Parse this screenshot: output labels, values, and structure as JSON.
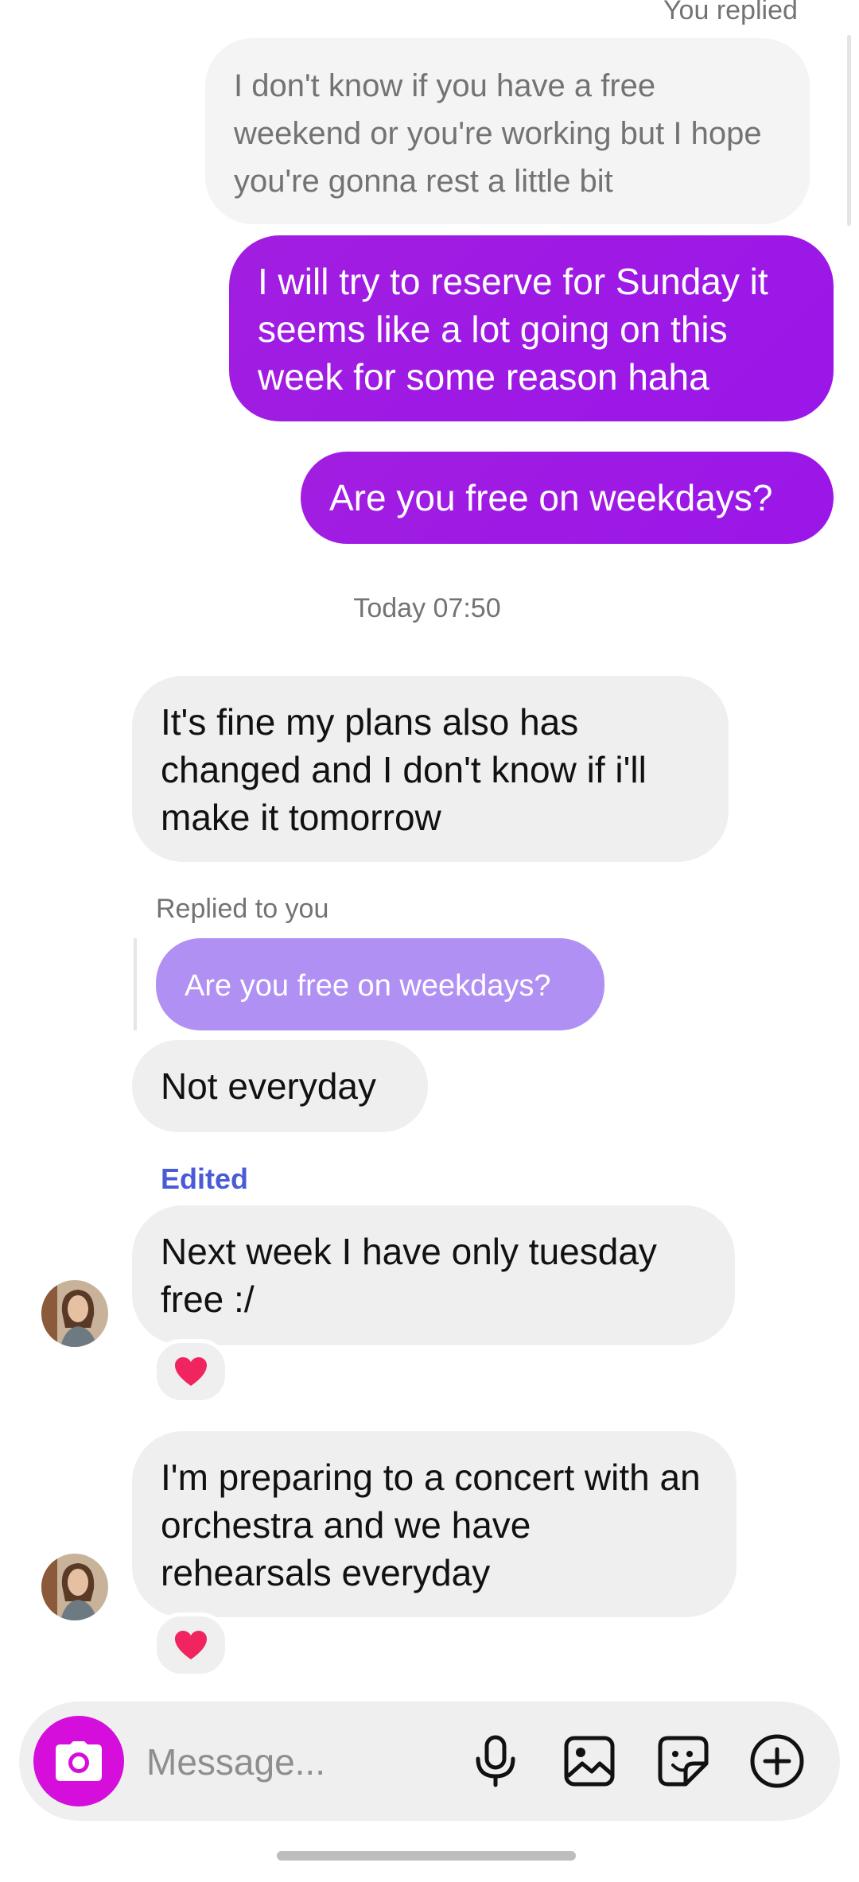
{
  "thread": {
    "you_replied_label": "You replied",
    "quoted_message": "I don't know if you have a free weekend or you're working but I hope you're gonna rest a little bit",
    "outgoing": [
      "I will try to reserve for Sunday it seems like a lot going on this week for some reason haha",
      "Are you free on weekdays?"
    ],
    "timestamp": "Today 07:50",
    "incoming_1": "It's fine my plans also has changed and I don't know if i'll make it tomorrow",
    "replied_to_label": "Replied to you",
    "reply_preview": "Are you free on weekdays?",
    "incoming_2": "Not everyday",
    "edited_label": "Edited",
    "incoming_3": "Next week I have only tuesday free :/",
    "incoming_4": "I'm preparing to a concert with an orchestra and we have rehearsals everyday",
    "reaction_emoji": "heart-icon"
  },
  "composer": {
    "placeholder": "Message...",
    "camera_icon": "camera-icon",
    "mic_icon": "microphone-icon",
    "gallery_icon": "gallery-icon",
    "sticker_icon": "sticker-icon",
    "more_icon": "plus-icon"
  },
  "colors": {
    "outgoing_bubble": "#a11ee0",
    "reply_preview": "#b190f4",
    "edited": "#4a5bd6",
    "camera_button": "#d50edb",
    "reaction_heart": "#f0245e"
  }
}
